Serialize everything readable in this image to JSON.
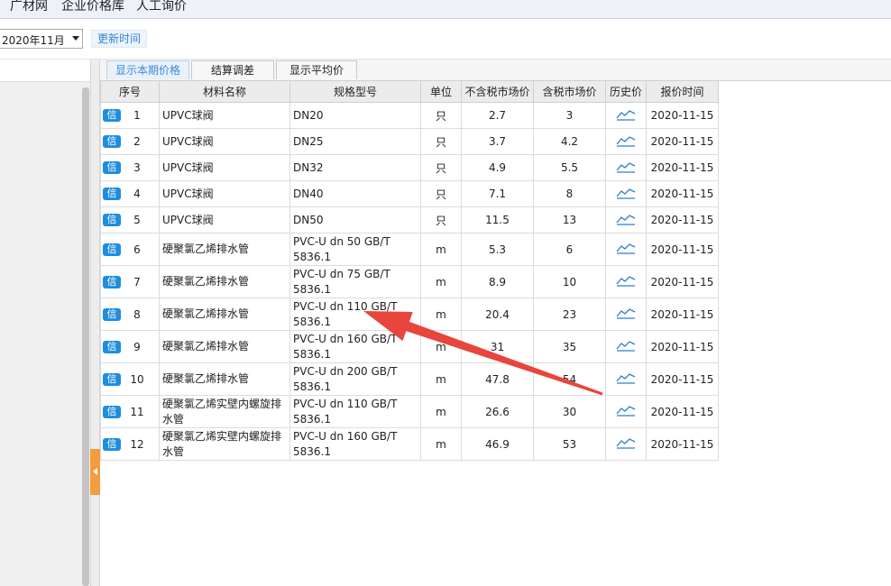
{
  "top_nav": [
    "广材网",
    "企业价格库",
    "人工询价"
  ],
  "toolbar": {
    "month": "2020年11月",
    "update_label": "更新时间"
  },
  "tabs": [
    "显示本期价格",
    "结算调差",
    "显示平均价"
  ],
  "table": {
    "headers": [
      "序号",
      "材料名称",
      "规格型号",
      "单位",
      "不含税市场价",
      "含税市场价",
      "历史价",
      "报价时间"
    ],
    "badge": "信",
    "rows": [
      {
        "seq": "1",
        "name": "UPVC球阀",
        "spec": "DN20",
        "unit": "只",
        "price_ex": "2.7",
        "price_in": "3",
        "date": "2020-11-15"
      },
      {
        "seq": "2",
        "name": "UPVC球阀",
        "spec": "DN25",
        "unit": "只",
        "price_ex": "3.7",
        "price_in": "4.2",
        "date": "2020-11-15"
      },
      {
        "seq": "3",
        "name": "UPVC球阀",
        "spec": "DN32",
        "unit": "只",
        "price_ex": "4.9",
        "price_in": "5.5",
        "date": "2020-11-15"
      },
      {
        "seq": "4",
        "name": "UPVC球阀",
        "spec": "DN40",
        "unit": "只",
        "price_ex": "7.1",
        "price_in": "8",
        "date": "2020-11-15"
      },
      {
        "seq": "5",
        "name": "UPVC球阀",
        "spec": "DN50",
        "unit": "只",
        "price_ex": "11.5",
        "price_in": "13",
        "date": "2020-11-15"
      },
      {
        "seq": "6",
        "name": "硬聚氯乙烯排水管",
        "spec": "PVC-U dn 50  GB/T 5836.1",
        "unit": "m",
        "price_ex": "5.3",
        "price_in": "6",
        "date": "2020-11-15"
      },
      {
        "seq": "7",
        "name": "硬聚氯乙烯排水管",
        "spec": "PVC-U dn 75  GB/T 5836.1",
        "unit": "m",
        "price_ex": "8.9",
        "price_in": "10",
        "date": "2020-11-15"
      },
      {
        "seq": "8",
        "name": "硬聚氯乙烯排水管",
        "spec": "PVC-U dn 110  GB/T 5836.1",
        "unit": "m",
        "price_ex": "20.4",
        "price_in": "23",
        "date": "2020-11-15"
      },
      {
        "seq": "9",
        "name": "硬聚氯乙烯排水管",
        "spec": "PVC-U dn 160  GB/T 5836.1",
        "unit": "m",
        "price_ex": "31",
        "price_in": "35",
        "date": "2020-11-15"
      },
      {
        "seq": "10",
        "name": "硬聚氯乙烯排水管",
        "spec": "PVC-U dn 200  GB/T 5836.1",
        "unit": "m",
        "price_ex": "47.8",
        "price_in": "54",
        "date": "2020-11-15"
      },
      {
        "seq": "11",
        "name": "硬聚氯乙烯实壁内螺旋排水管",
        "spec": "PVC-U dn 110  GB/T 5836.1",
        "unit": "m",
        "price_ex": "26.6",
        "price_in": "30",
        "date": "2020-11-15"
      },
      {
        "seq": "12",
        "name": "硬聚氯乙烯实壁内螺旋排水管",
        "spec": "PVC-U dn 160  GB/T 5836.1",
        "unit": "m",
        "price_ex": "46.9",
        "price_in": "53",
        "date": "2020-11-15"
      }
    ]
  },
  "colors": {
    "badge": "#1d8de0",
    "arrow": "#e8453c",
    "active_tab_text": "#3a8ad6",
    "collapse_tab": "#f29d3f"
  }
}
